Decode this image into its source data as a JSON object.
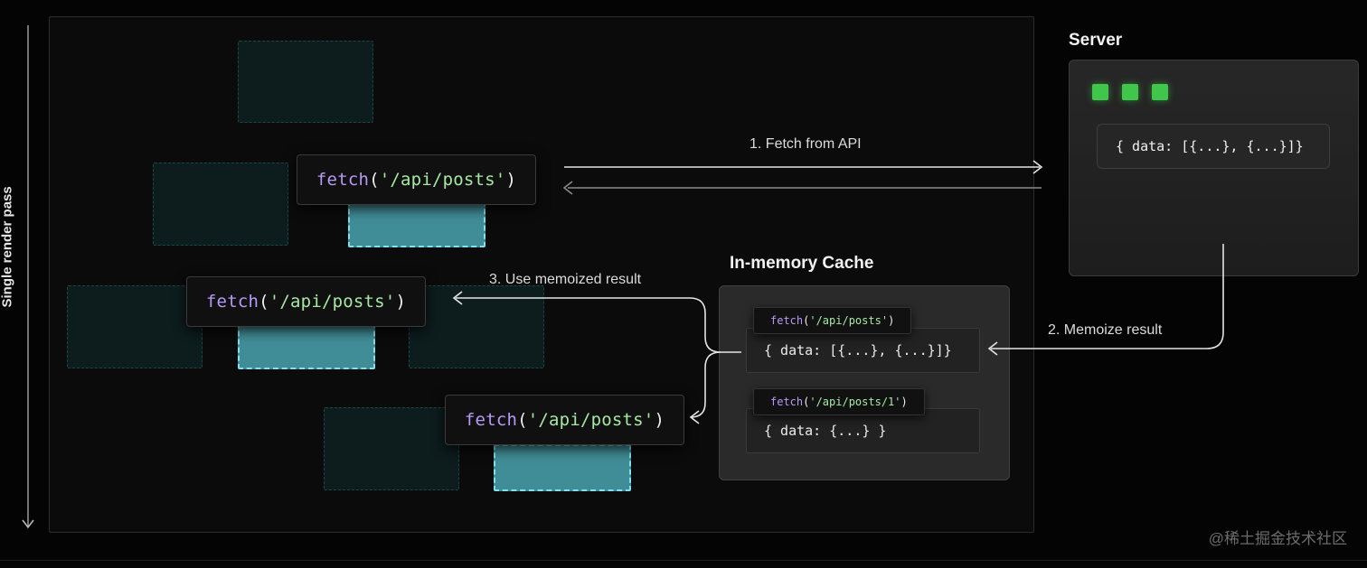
{
  "render_axis": {
    "label": "Single render pass"
  },
  "components": {
    "fetch_call": {
      "fn": "fetch",
      "open": "(",
      "arg": "'/api/posts'",
      "close": ")"
    }
  },
  "arrows": {
    "fetch_from_api": "1. Fetch from API",
    "memoize_result": "2. Memoize result",
    "use_memoized": "3. Use memoized result"
  },
  "server": {
    "title": "Server",
    "response": "{ data: [{...}, {...}]}"
  },
  "cache": {
    "title": "In-memory Cache",
    "entries": [
      {
        "key_fn": "fetch",
        "key_open": "(",
        "key_arg": "'/api/posts'",
        "key_close": ")",
        "value": "{ data: [{...}, {...}]}"
      },
      {
        "key_fn": "fetch",
        "key_open": "(",
        "key_arg": "'/api/posts/1'",
        "key_close": ")",
        "value": "{ data: {...} }"
      }
    ]
  },
  "colors": {
    "fetch_fn": "#b79af7",
    "fetch_string": "#a6e9a4",
    "active_component": "#418d97",
    "server_status": "#3fc64b"
  },
  "watermark": "@稀土掘金技术社区"
}
